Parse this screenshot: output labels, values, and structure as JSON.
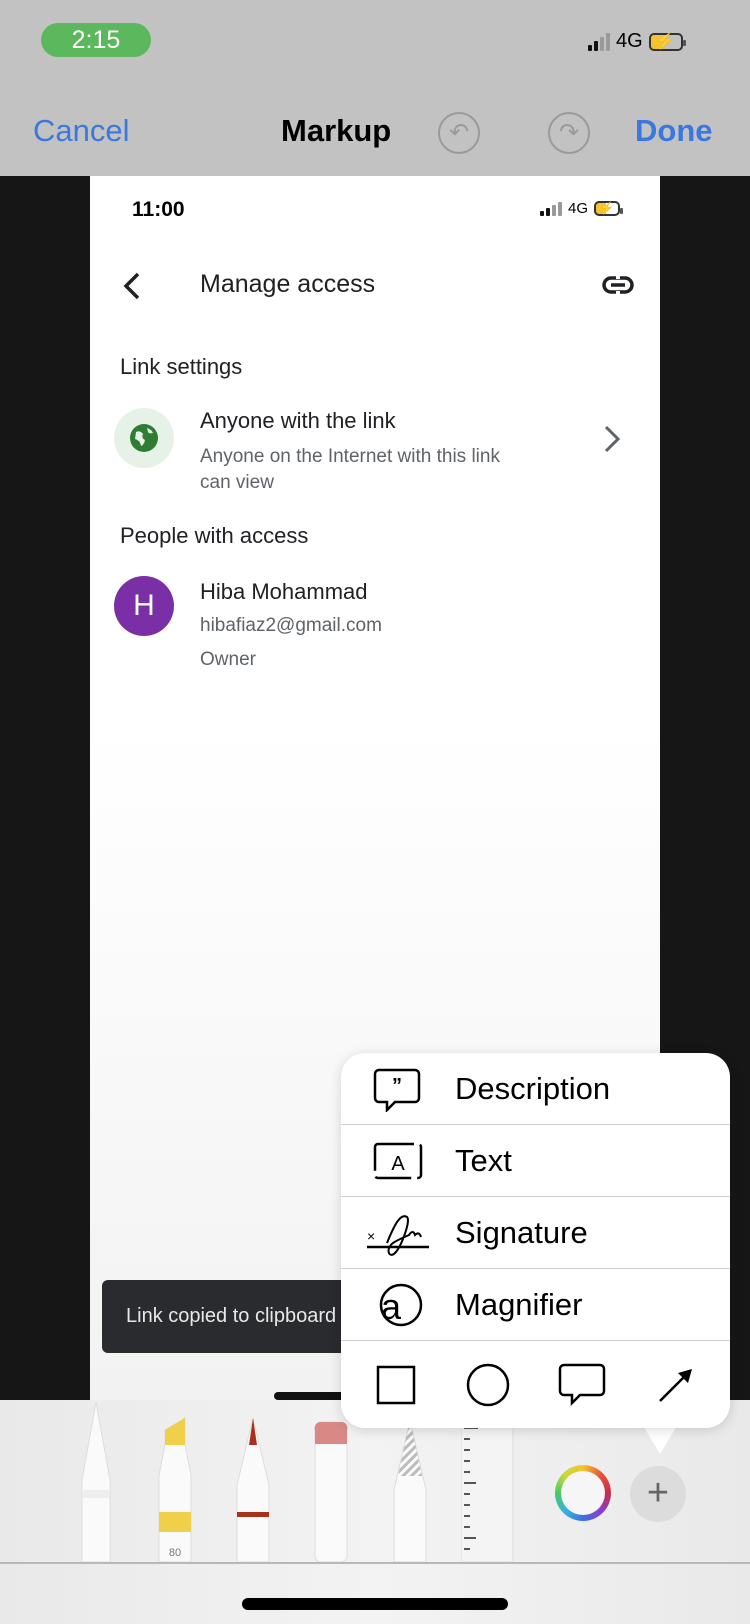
{
  "status_bar": {
    "time": "2:15",
    "network": "4G"
  },
  "nav": {
    "cancel": "Cancel",
    "title": "Markup",
    "undo_icon": "undo-icon",
    "redo_icon": "redo-icon",
    "done": "Done",
    "accent": "#3a78e0"
  },
  "screenshot": {
    "status": {
      "time": "11:00",
      "network": "4G"
    },
    "header": {
      "title": "Manage access"
    },
    "link_settings": {
      "heading": "Link settings",
      "title": "Anyone with the link",
      "subtitle_line1": "Anyone on the Internet with this link",
      "subtitle_line2": "can view"
    },
    "people": {
      "heading": "People with access",
      "avatar_letter": "H",
      "avatar_color": "#7b2fa6",
      "name": "Hiba Mohammad",
      "email": "hibafiaz2@gmail.com",
      "role": "Owner"
    },
    "snackbar": "Link copied to clipboard"
  },
  "popover": {
    "items": [
      {
        "label": "Description",
        "icon": "quote-bubble-icon"
      },
      {
        "label": "Text",
        "icon": "text-box-icon"
      },
      {
        "label": "Signature",
        "icon": "signature-icon"
      },
      {
        "label": "Magnifier",
        "icon": "magnifier-icon"
      }
    ],
    "shapes": [
      "square-icon",
      "circle-icon",
      "speech-bubble-icon",
      "arrow-icon"
    ]
  },
  "toolbar": {
    "tools": [
      "pen",
      "highlighter",
      "pencil",
      "eraser",
      "lasso",
      "ruler"
    ],
    "highlighter_width": "80",
    "highlighter_color": "#f0cf4a",
    "pencil_color": "#a8311c"
  }
}
